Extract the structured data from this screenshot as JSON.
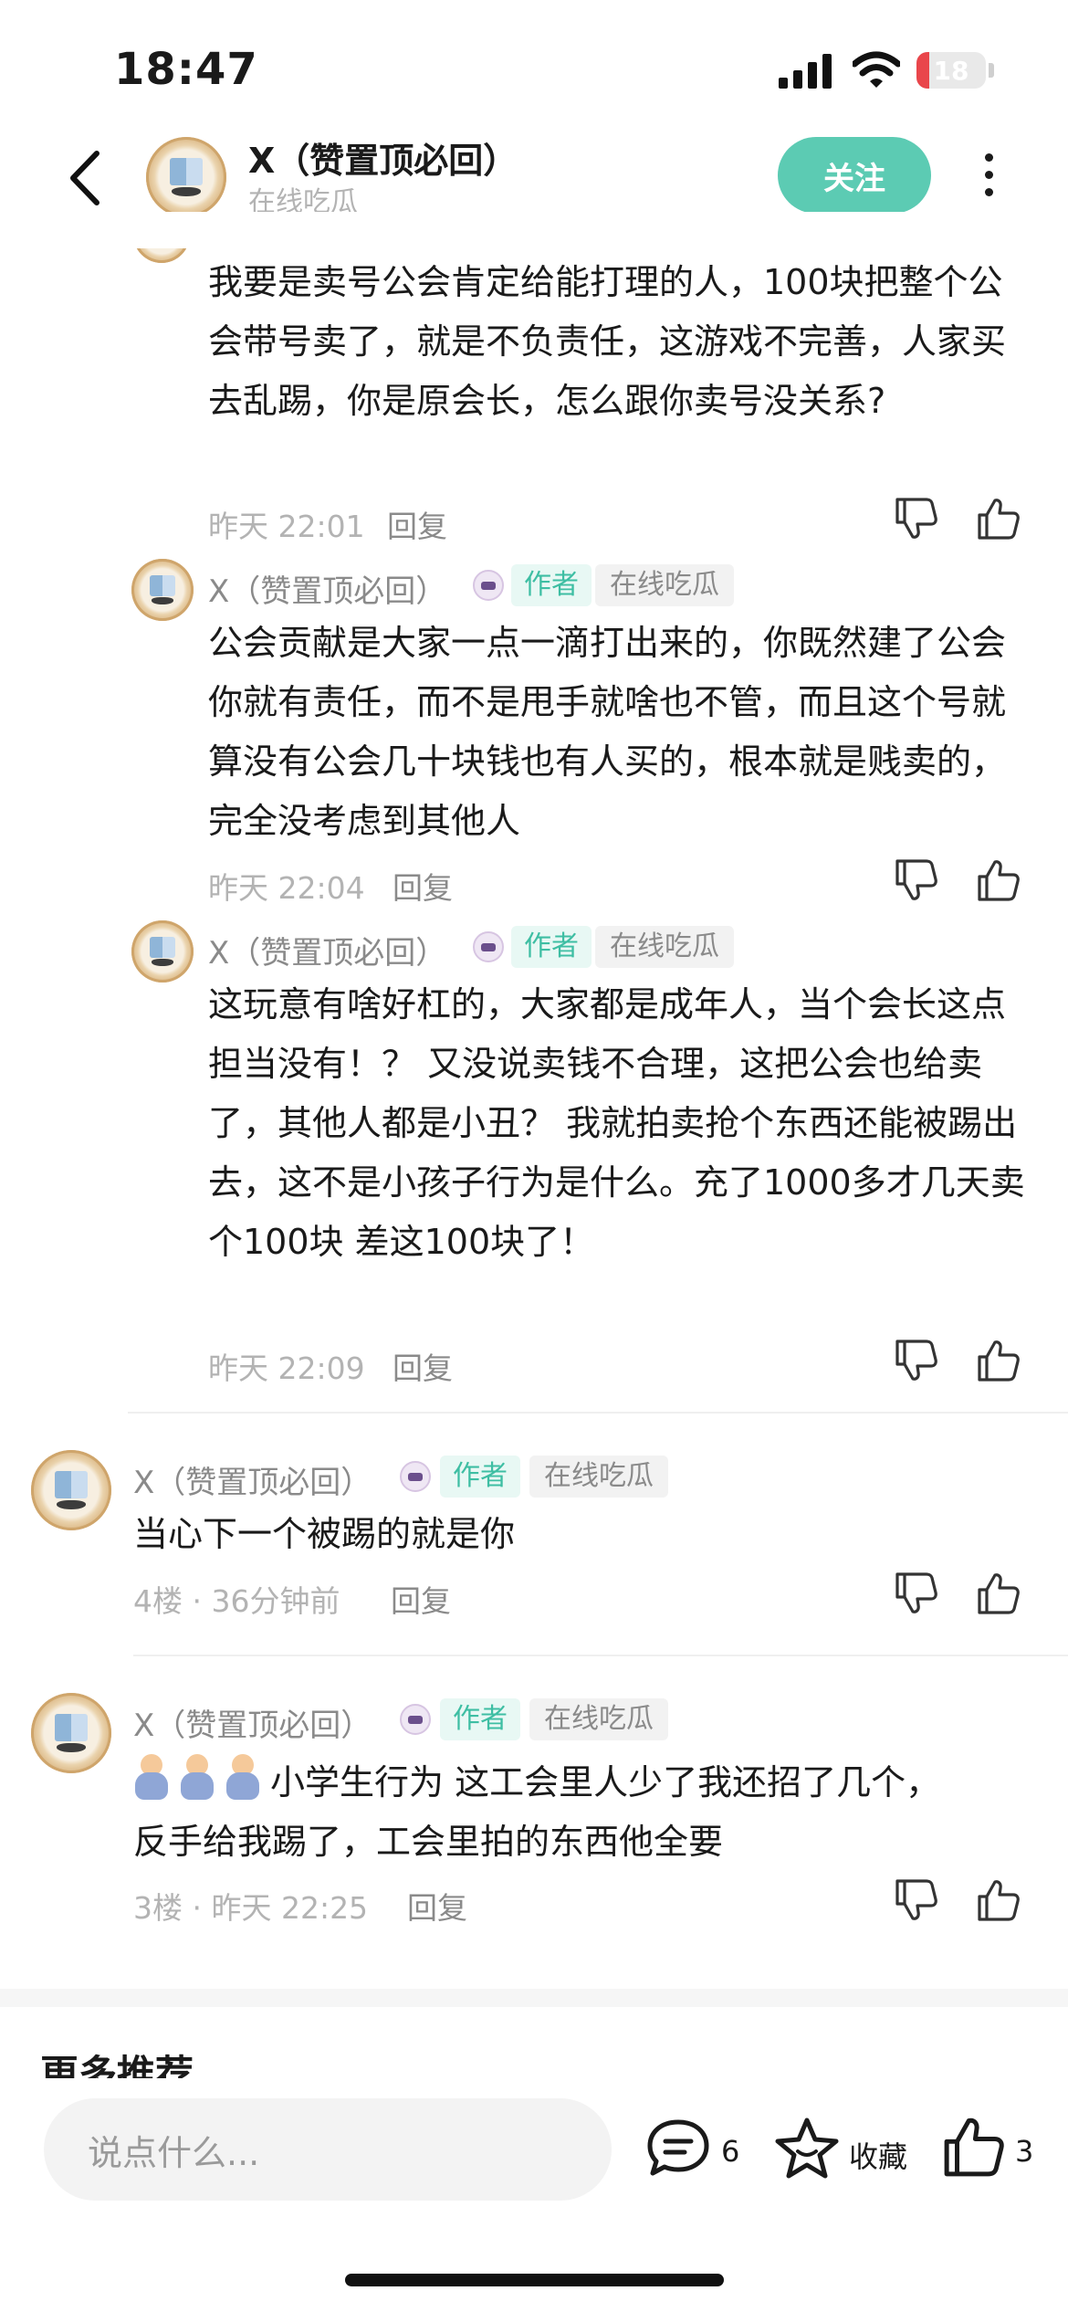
{
  "status_bar": {
    "time": "18:47",
    "battery": "18",
    "battery_level": 0.18
  },
  "header": {
    "title": "X（赞置顶必回）",
    "subtitle": "在线吃瓜",
    "follow_label": "关注"
  },
  "comments": [
    {
      "body": "我要是卖号公会肯定给能打理的人，100块把整个公会带号卖了，就是不负责任，这游戏不完善，人家买去乱踢，你是原会长，怎么跟你卖号没关系?",
      "meta": "昨天 22:01",
      "reply": "回复"
    },
    {
      "name": "X（赞置顶必回）",
      "tag_author": "作者",
      "tag_status": "在线吃瓜",
      "body": "公会贡献是大家一点一滴打出来的，你既然建了公会你就有责任，而不是甩手就啥也不管，而且这个号就算没有公会几十块钱也有人买的，根本就是贱卖的，完全没考虑到其他人",
      "meta": "昨天 22:04",
      "reply": "回复"
    },
    {
      "name": "X（赞置顶必回）",
      "tag_author": "作者",
      "tag_status": "在线吃瓜",
      "body": "这玩意有啥好杠的，大家都是成年人，当个会长这点担当没有！？ 又没说卖钱不合理，这把公会也给卖了，其他人都是小丑？ 我就拍卖抢个东西还能被踢出去，这不是小孩子行为是什么。充了1000多才几天卖个100块 差这100块了！",
      "meta": "昨天 22:09",
      "reply": "回复"
    },
    {
      "name": "X（赞置顶必回）",
      "tag_author": "作者",
      "tag_status": "在线吃瓜",
      "body": "当心下一个被踢的就是你",
      "meta": "4楼 · 36分钟前",
      "reply": "回复"
    },
    {
      "name": "X（赞置顶必回）",
      "tag_author": "作者",
      "tag_status": "在线吃瓜",
      "body": "小学生行为 这工会里人少了我还招了几个，反手给我踢了，工会里拍的东西他全要",
      "meta": "3楼 · 昨天 22:25",
      "reply": "回复"
    }
  ],
  "section": {
    "more_recommend": "更多推荐"
  },
  "bottom_bar": {
    "input_placeholder": "说点什么...",
    "comment_count": "6",
    "favorite_label": "收藏",
    "like_count": "3"
  },
  "colors": {
    "accent": "#5ccbb3",
    "author_tag_text": "#3ebea3",
    "author_tag_bg": "#e8f8f4",
    "muted": "#b3b3b3",
    "battery_red": "#e9464b"
  },
  "icons": [
    "back-icon",
    "more-icon",
    "dislike-icon",
    "like-icon",
    "comment-bubble-icon",
    "star-icon",
    "wifi-icon",
    "signal-icon"
  ]
}
